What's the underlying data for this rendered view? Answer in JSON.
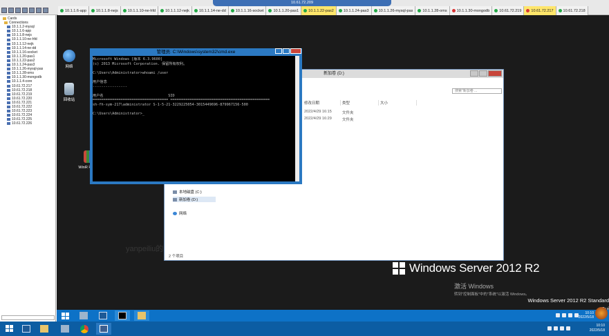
{
  "connection_title": "10.61.72.209",
  "tabs": [
    {
      "label": "10.1.1.6-app",
      "state": "green"
    },
    {
      "label": "10.1.1.8-nejs",
      "state": "green"
    },
    {
      "label": "10.1.1.10-ne-hfd",
      "state": "green"
    },
    {
      "label": "10.1.1.12-nejk",
      "state": "green"
    },
    {
      "label": "10.1.1.14-ne-dd",
      "state": "green"
    },
    {
      "label": "10.1.1.16-socket",
      "state": "green"
    },
    {
      "label": "10.1.1.20-pas1",
      "state": "green"
    },
    {
      "label": "10.1.1.22-pas2",
      "state": "green",
      "active": true
    },
    {
      "label": "10.1.1.24-pas3",
      "state": "green"
    },
    {
      "label": "10.1.1.26-mysql-pas",
      "state": "green"
    },
    {
      "label": "10.1.1.28-oms",
      "state": "green"
    },
    {
      "label": "10.1.1.30-mongodb",
      "state": "red"
    },
    {
      "label": "10.61.72.219",
      "state": "green"
    },
    {
      "label": "10.61.72.217",
      "state": "red",
      "active": true
    },
    {
      "label": "10.61.72.218",
      "state": "green"
    }
  ],
  "tree": {
    "root": "Cards",
    "connections_label": "Connections",
    "items": [
      "10.1.1.2-mysql",
      "10.1.1.6-app",
      "10.1.1.8-nejs",
      "10.1.1.10-ne-hfd",
      "10.1.1.12-nejk",
      "10.1.1.14-ne-dd",
      "10.1.1.16-socket",
      "10.1.1.20-pas1",
      "10.1.1.22-pas2",
      "10.1.1.24-pas3",
      "10.1.1.26-mysql-pas",
      "10.1.1.28-oms",
      "10.1.1.30-mongodb",
      "10.1.1.4-core",
      "10.61.72.217",
      "10.61.72.218",
      "10.61.72.219",
      "10.61.72.220",
      "10.61.72.221",
      "10.61.72.222",
      "10.61.72.223",
      "10.61.72.224",
      "10.61.72.225",
      "10.61.72.226"
    ]
  },
  "desktop": {
    "icons": [
      {
        "label": "网络",
        "color": "#3a86d6"
      },
      {
        "label": "回收站",
        "color": "#8aa8c8"
      },
      {
        "label": "WinR 收_S",
        "color": "#c84a3a"
      }
    ],
    "brand": "Windows Server 2012 R2",
    "activate_title": "激活 Windows",
    "activate_sub": "转到\"控制面板\"中的\"系统\"以激活 Windows。",
    "edition": "Windows Server 2012 R2 Standard",
    "build": "Bui",
    "watermark": "yanpeiliu的IT"
  },
  "cmd": {
    "title": "管理员: C:\\Windows\\system32\\cmd.exe",
    "lines": [
      "Microsoft Windows [版本 6.3.9600]",
      "(c) 2013 Microsoft Corporation. 保留所有权利。",
      "",
      "C:\\Users\\Administrator>whoami /user",
      "",
      "用户信息",
      "----------------",
      "",
      "用户名                              SID",
      "=================================== ==============================================",
      "sh-fh-sym-217\\administrator S-1-5-21-3229225054-3015449696-879967156-500",
      "",
      "C:\\Users\\Administrator>_"
    ]
  },
  "explorer": {
    "title": "新加卷 (D:)",
    "search_placeholder": "搜索\"新加卷 ...",
    "columns": [
      "修改日期",
      "类型",
      "大小"
    ],
    "rows": [
      {
        "date": "2022/4/29 16:15",
        "type": "文件夹"
      },
      {
        "date": "2022/4/29 16:29",
        "type": "文件夹"
      }
    ],
    "nav": [
      {
        "label": "本地磁盘 (C:)",
        "selected": false
      },
      {
        "label": "新加卷 (D:)",
        "selected": true
      },
      {
        "label": "网络",
        "selected": false
      }
    ],
    "status": "2 个项目"
  },
  "remote_tray": {
    "time": "10:10",
    "date": "2022/5/18"
  },
  "host_tray": {
    "time": "10:10",
    "date": "2022/5/18"
  }
}
